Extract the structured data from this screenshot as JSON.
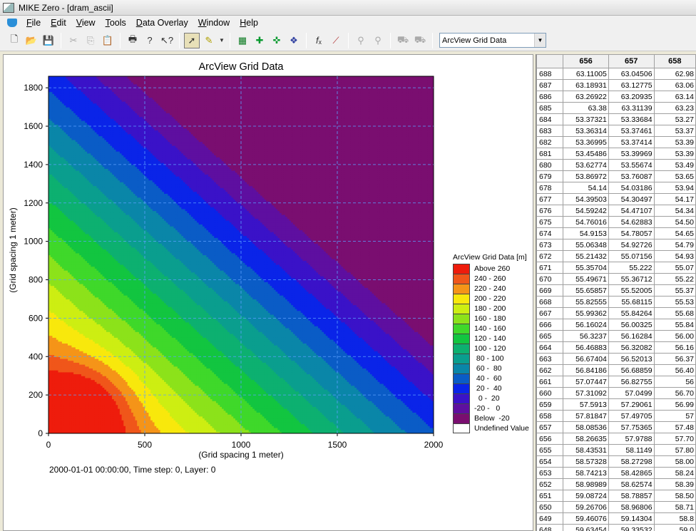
{
  "window": {
    "title": "MIKE Zero - [dram_ascii]"
  },
  "menu": {
    "items": [
      {
        "label": "File",
        "key": "F",
        "rest": "ile"
      },
      {
        "label": "Edit",
        "key": "E",
        "rest": "dit"
      },
      {
        "label": "View",
        "key": "V",
        "rest": "iew"
      },
      {
        "label": "Tools",
        "key": "T",
        "rest": "ools"
      },
      {
        "label": "Data Overlay",
        "key": "D",
        "rest": "ata Overlay"
      },
      {
        "label": "Window",
        "key": "W",
        "rest": "indow"
      },
      {
        "label": "Help",
        "key": "H",
        "rest": "elp"
      }
    ]
  },
  "toolbar": {
    "item_select": "ArcView Grid Data",
    "icons": [
      "new-icon",
      "open-icon",
      "save-icon",
      "cut-icon",
      "copy-icon",
      "paste-icon",
      "print-icon",
      "help-icon",
      "context-help-icon",
      "pointer-icon",
      "pen-icon",
      "grid-icon",
      "add-node-icon",
      "edit-node-icon",
      "refine-icon",
      "formula-icon",
      "line-icon",
      "probe-icon",
      "probe2-icon",
      "layer-up-icon",
      "layer-down-icon"
    ]
  },
  "chart": {
    "title": "ArcView Grid Data",
    "status": "2000-01-01 00:00:00, Time step: 0, Layer: 0"
  },
  "chart_data": {
    "type": "heatmap",
    "title": "ArcView Grid Data",
    "xlabel": "(Grid spacing 1 meter)",
    "ylabel": "(Grid spacing 1 meter)",
    "xlim": [
      0,
      2000
    ],
    "ylim": [
      0,
      1860
    ],
    "xticks": [
      0,
      500,
      1000,
      1500,
      2000
    ],
    "yticks": [
      0,
      200,
      400,
      600,
      800,
      1000,
      1200,
      1400,
      1600,
      1800
    ],
    "grid": true,
    "legend_title": "ArcView Grid Data [m]",
    "legend_position": "right",
    "legend": [
      {
        "label": "Above 260",
        "color": "#ee1c0c"
      },
      {
        "label": "240 - 260",
        "color": "#f0561a"
      },
      {
        "label": "220 - 240",
        "color": "#f59418"
      },
      {
        "label": "200 - 220",
        "color": "#f8e80c"
      },
      {
        "label": "180 - 200",
        "color": "#cdee12"
      },
      {
        "label": "160 - 180",
        "color": "#8ce21a"
      },
      {
        "label": "140 - 160",
        "color": "#3fd82a"
      },
      {
        "label": "120 - 140",
        "color": "#12c540"
      },
      {
        "label": "100 - 120",
        "color": "#0db070"
      },
      {
        "label": " 80 - 100",
        "color": "#0a9e8e"
      },
      {
        "label": " 60 -  80",
        "color": "#0a86a8"
      },
      {
        "label": " 40 -  60",
        "color": "#0a5cc6"
      },
      {
        "label": " 20 -  40",
        "color": "#0a24e8"
      },
      {
        "label": "  0 -  20",
        "color": "#3a12c8"
      },
      {
        "label": "-20 -   0",
        "color": "#5e0fa0"
      },
      {
        "label": "Below  -20",
        "color": "#7a0e70"
      },
      {
        "label": "Undefined Value",
        "color": "#ffffff"
      }
    ]
  },
  "table": {
    "columns": [
      "",
      "656",
      "657",
      "658"
    ],
    "rows": [
      [
        "688",
        "63.11005",
        "63.04506",
        "62.98"
      ],
      [
        "687",
        "63.18931",
        "63.12775",
        "63.06"
      ],
      [
        "686",
        "63.26922",
        "63.20935",
        "63.14"
      ],
      [
        "685",
        "63.38",
        "63.31139",
        "63.23"
      ],
      [
        "684",
        "53.37321",
        "53.33684",
        "53.27"
      ],
      [
        "683",
        "53.36314",
        "53.37461",
        "53.37"
      ],
      [
        "682",
        "53.36995",
        "53.37414",
        "53.39"
      ],
      [
        "681",
        "53.45486",
        "53.39969",
        "53.39"
      ],
      [
        "680",
        "53.62774",
        "53.55674",
        "53.49"
      ],
      [
        "679",
        "53.86972",
        "53.76087",
        "53.65"
      ],
      [
        "678",
        "54.14",
        "54.03186",
        "53.94"
      ],
      [
        "677",
        "54.39503",
        "54.30497",
        "54.17"
      ],
      [
        "676",
        "54.59242",
        "54.47107",
        "54.34"
      ],
      [
        "675",
        "54.76016",
        "54.62883",
        "54.50"
      ],
      [
        "674",
        "54.9153",
        "54.78057",
        "54.65"
      ],
      [
        "673",
        "55.06348",
        "54.92726",
        "54.79"
      ],
      [
        "672",
        "55.21432",
        "55.07156",
        "54.93"
      ],
      [
        "671",
        "55.35704",
        "55.222",
        "55.07"
      ],
      [
        "670",
        "55.49671",
        "55.36712",
        "55.22"
      ],
      [
        "669",
        "55.65857",
        "55.52005",
        "55.37"
      ],
      [
        "668",
        "55.82555",
        "55.68115",
        "55.53"
      ],
      [
        "667",
        "55.99362",
        "55.84264",
        "55.68"
      ],
      [
        "666",
        "56.16024",
        "56.00325",
        "55.84"
      ],
      [
        "665",
        "56.3237",
        "56.16284",
        "56.00"
      ],
      [
        "664",
        "56.46883",
        "56.32082",
        "56.16"
      ],
      [
        "663",
        "56.67404",
        "56.52013",
        "56.37"
      ],
      [
        "662",
        "56.84186",
        "56.68859",
        "56.40"
      ],
      [
        "661",
        "57.07447",
        "56.82755",
        "56"
      ],
      [
        "660",
        "57.31092",
        "57.0499",
        "56.70"
      ],
      [
        "659",
        "57.5913",
        "57.29061",
        "56.99"
      ],
      [
        "658",
        "57.81847",
        "57.49705",
        "57"
      ],
      [
        "657",
        "58.08536",
        "57.75365",
        "57.48"
      ],
      [
        "656",
        "58.26635",
        "57.9788",
        "57.70"
      ],
      [
        "655",
        "58.43531",
        "58.1149",
        "57.80"
      ],
      [
        "654",
        "58.57328",
        "58.27298",
        "58.00"
      ],
      [
        "653",
        "58.74213",
        "58.42865",
        "58.24"
      ],
      [
        "652",
        "58.98989",
        "58.62574",
        "58.39"
      ],
      [
        "651",
        "59.08724",
        "58.78857",
        "58.50"
      ],
      [
        "650",
        "59.26706",
        "58.96806",
        "58.71"
      ],
      [
        "649",
        "59.46076",
        "59.14304",
        "58.8"
      ],
      [
        "648",
        "59.63454",
        "59.33532",
        "59.0"
      ]
    ]
  }
}
